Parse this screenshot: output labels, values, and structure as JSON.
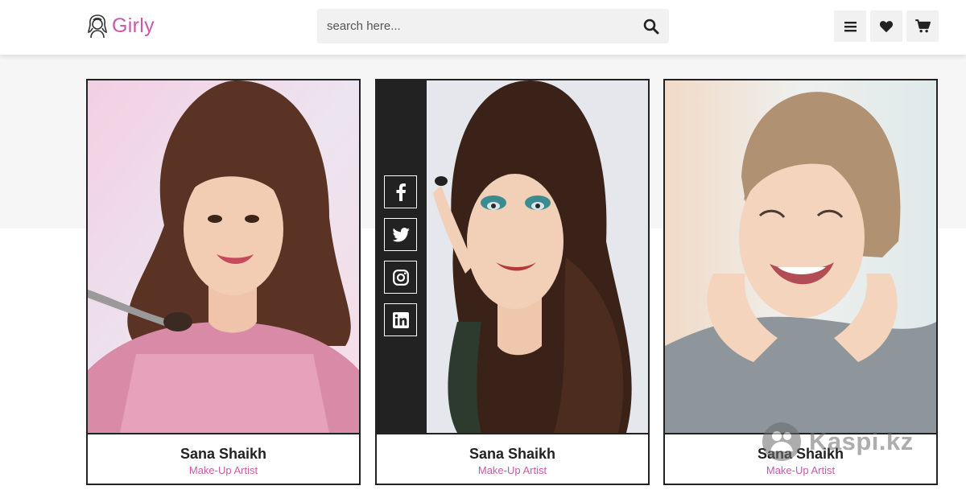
{
  "brand": {
    "name": "Girly"
  },
  "search": {
    "placeholder": "search here..."
  },
  "header_icons": [
    "bars-icon",
    "heart-icon",
    "cart-icon"
  ],
  "colors": {
    "accent": "#c75aa8",
    "dark": "#222222",
    "panel": "#f1f1f1"
  },
  "cards": [
    {
      "name": "Sana Shaikh",
      "role": "Make-Up Artist"
    },
    {
      "name": "Sana Shaikh",
      "role": "Make-Up Artist",
      "social": [
        "facebook-icon",
        "twitter-icon",
        "instagram-icon",
        "linkedin-icon"
      ]
    },
    {
      "name": "Sana Shaikh",
      "role": "Make-Up Artist"
    }
  ],
  "watermark": {
    "text": "Kaspi.kz"
  }
}
